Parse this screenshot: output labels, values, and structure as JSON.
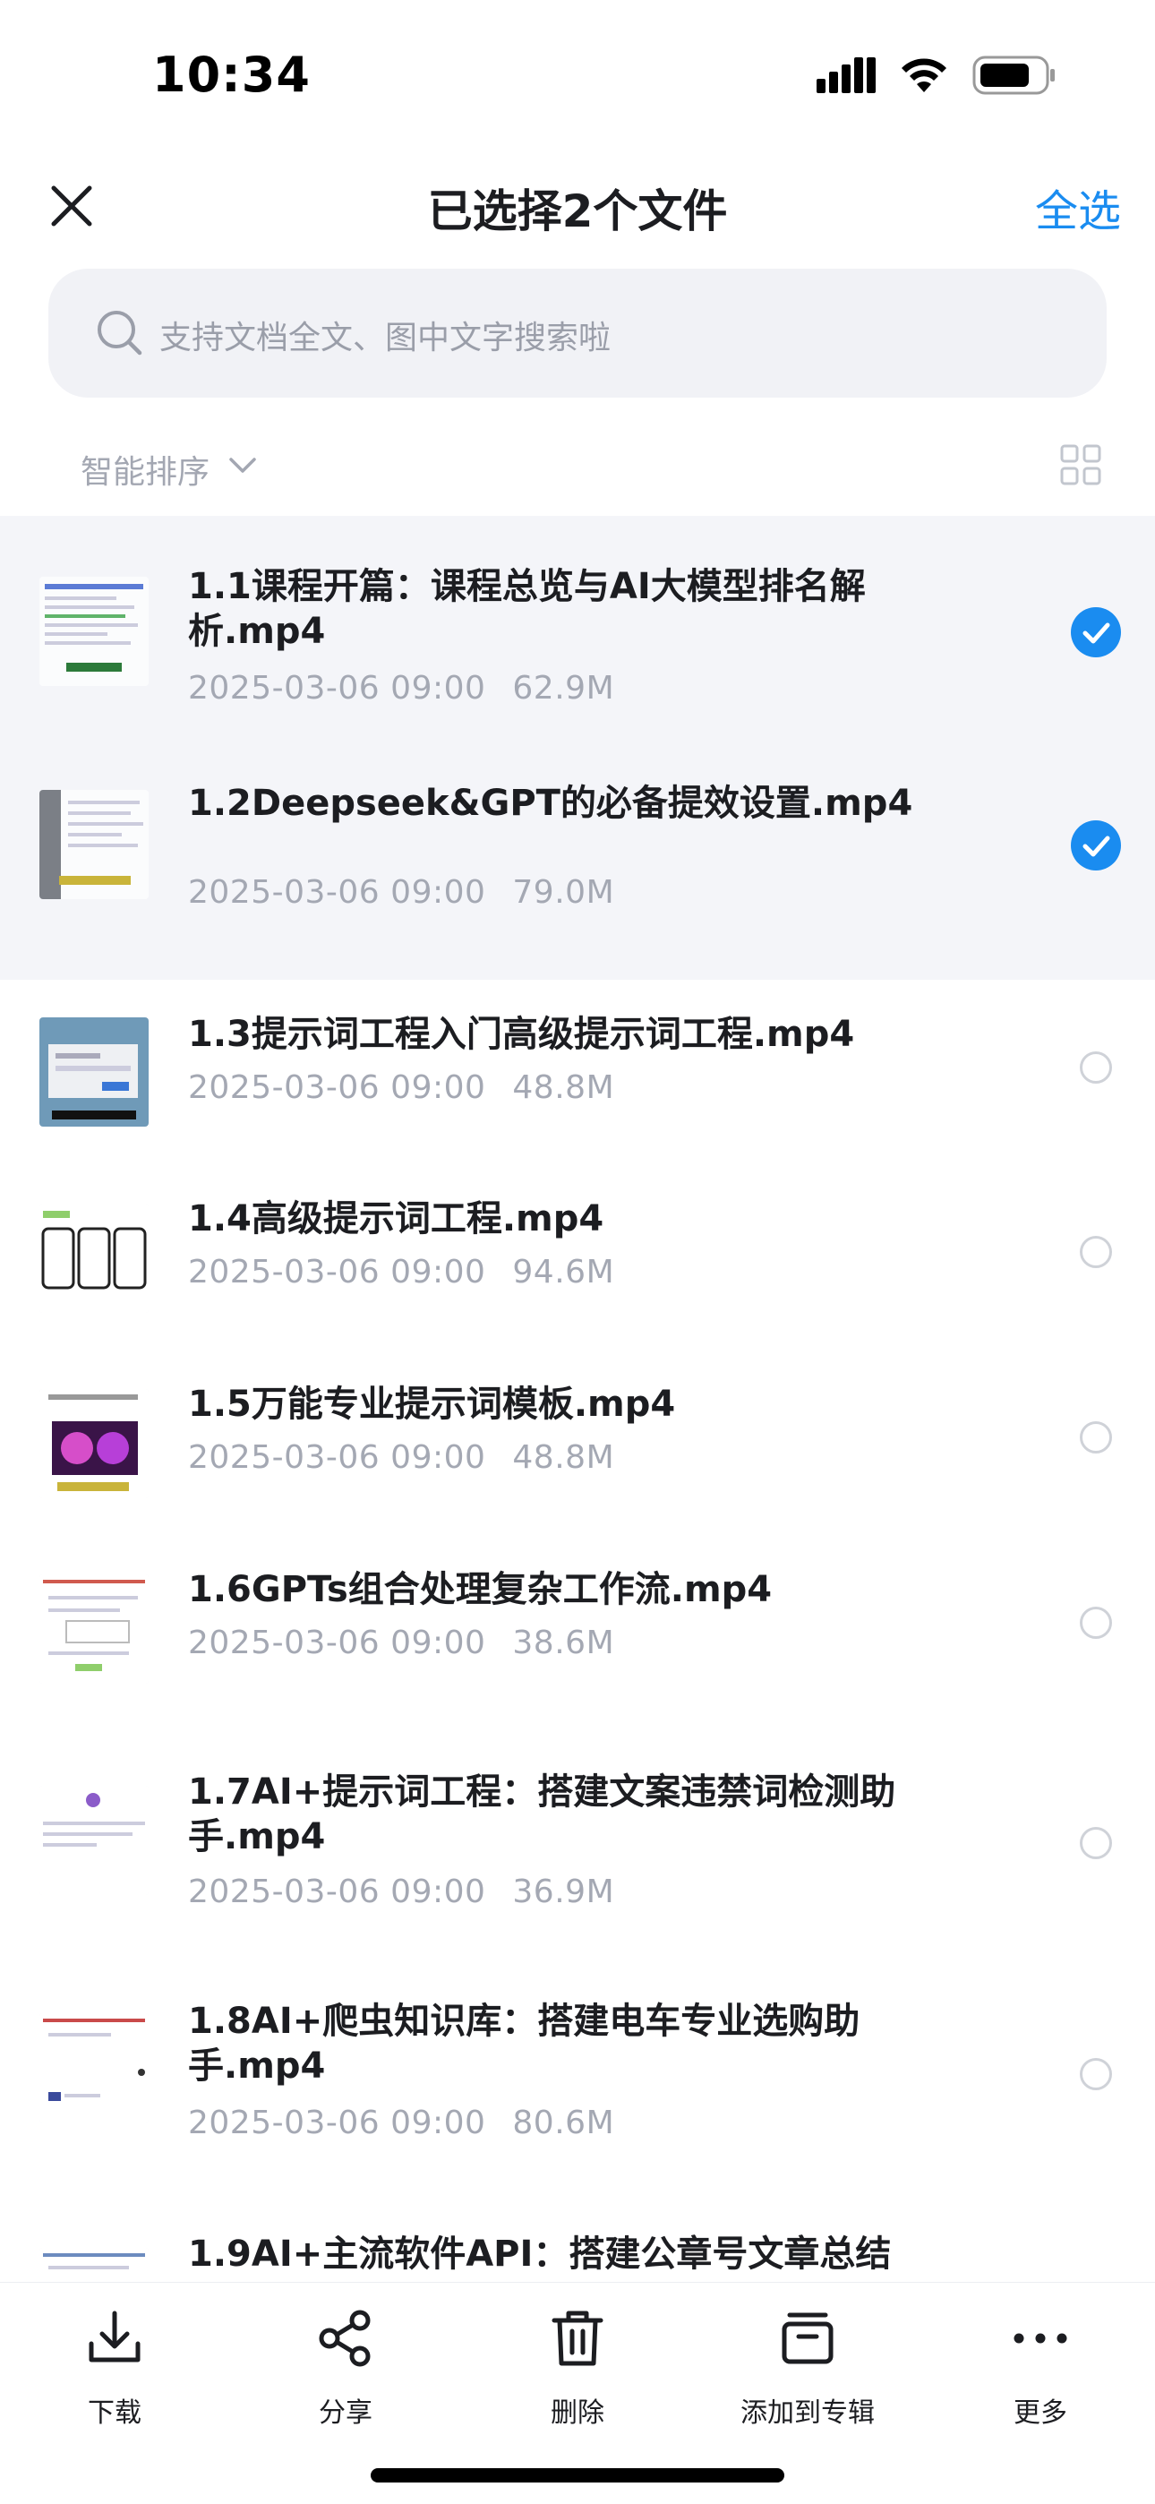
{
  "status": {
    "time": "10:34"
  },
  "nav": {
    "title": "已选择2个文件",
    "select_all": "全选"
  },
  "search": {
    "placeholder": "支持文档全文、图中文字搜索啦"
  },
  "sort": {
    "label": "智能排序"
  },
  "colors": {
    "accent": "#1a8cf0",
    "selected_row_bg": "#f4f5f9",
    "meta_text": "#a4a8b3"
  },
  "files": [
    {
      "name": "1.1课程开篇：课程总览与AI大模型排名解析.mp4",
      "date": "2025-03-06 09:00",
      "size": "62.9M",
      "selected": true
    },
    {
      "name": "1.2Deepseek&GPT的必备提效设置.mp4",
      "date": "2025-03-06 09:00",
      "size": "79.0M",
      "selected": true
    },
    {
      "name": "1.3提示词工程入门高级提示词工程.mp4",
      "date": "2025-03-06 09:00",
      "size": "48.8M",
      "selected": false
    },
    {
      "name": "1.4高级提示词工程.mp4",
      "date": "2025-03-06 09:00",
      "size": "94.6M",
      "selected": false
    },
    {
      "name": "1.5万能专业提示词模板.mp4",
      "date": "2025-03-06 09:00",
      "size": "48.8M",
      "selected": false
    },
    {
      "name": "1.6GPTs组合处理复杂工作流.mp4",
      "date": "2025-03-06 09:00",
      "size": "38.6M",
      "selected": false
    },
    {
      "name": "1.7AI+提示词工程：搭建文案违禁词检测助手.mp4",
      "date": "2025-03-06 09:00",
      "size": "36.9M",
      "selected": false
    },
    {
      "name": "1.8AI+爬虫知识库：搭建电车专业选购助手.mp4",
      "date": "2025-03-06 09:00",
      "size": "80.6M",
      "selected": false
    },
    {
      "name": "1.9AI+主流软件API：搭建公章号文章总结",
      "date": "",
      "size": "",
      "selected": false
    }
  ],
  "toolbar": {
    "download": "下载",
    "share": "分享",
    "delete": "删除",
    "add_to_album": "添加到专辑",
    "more": "更多"
  }
}
